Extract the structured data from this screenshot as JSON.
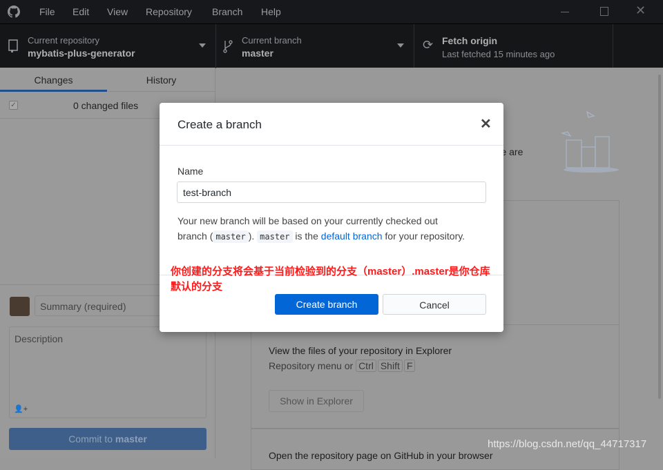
{
  "menu": [
    "File",
    "Edit",
    "View",
    "Repository",
    "Branch",
    "Help"
  ],
  "toolbar": {
    "repo": {
      "label": "Current repository",
      "value": "mybatis-plus-generator"
    },
    "branch": {
      "label": "Current branch",
      "value": "master"
    },
    "fetch": {
      "label": "Fetch origin",
      "sub": "Last fetched 15 minutes ago"
    }
  },
  "sidebar": {
    "tabs": [
      "Changes",
      "History"
    ],
    "changed_files": "0 changed files",
    "summary_placeholder": "Summary (required)",
    "description_placeholder": "Description",
    "commit_prefix": "Commit to ",
    "commit_branch": "master"
  },
  "main": {
    "partial_text": "ere are",
    "explorer_title": "View the files of your repository in Explorer",
    "explorer_hint": "Repository menu or",
    "keys": [
      "Ctrl",
      "Shift",
      "F"
    ],
    "explorer_button": "Show in Explorer",
    "github_title": "Open the repository page on GitHub in your browser"
  },
  "dialog": {
    "title": "Create a branch",
    "name_label": "Name",
    "name_value": "test-branch",
    "desc1": "Your new branch will be based on your currently checked out branch (",
    "code1": "master",
    "desc2": "). ",
    "code2": "master",
    "desc3": " is the ",
    "link": "default branch",
    "desc4": " for your repository.",
    "annotation": "你创建的分支将会基于当前检验到的分支（master）.master是你仓库默认的分支",
    "create": "Create branch",
    "cancel": "Cancel"
  },
  "watermark": "https://blog.csdn.net/qq_44717317",
  "colors": {
    "accent": "#0366d6",
    "annotation": "#ff1a1a"
  }
}
